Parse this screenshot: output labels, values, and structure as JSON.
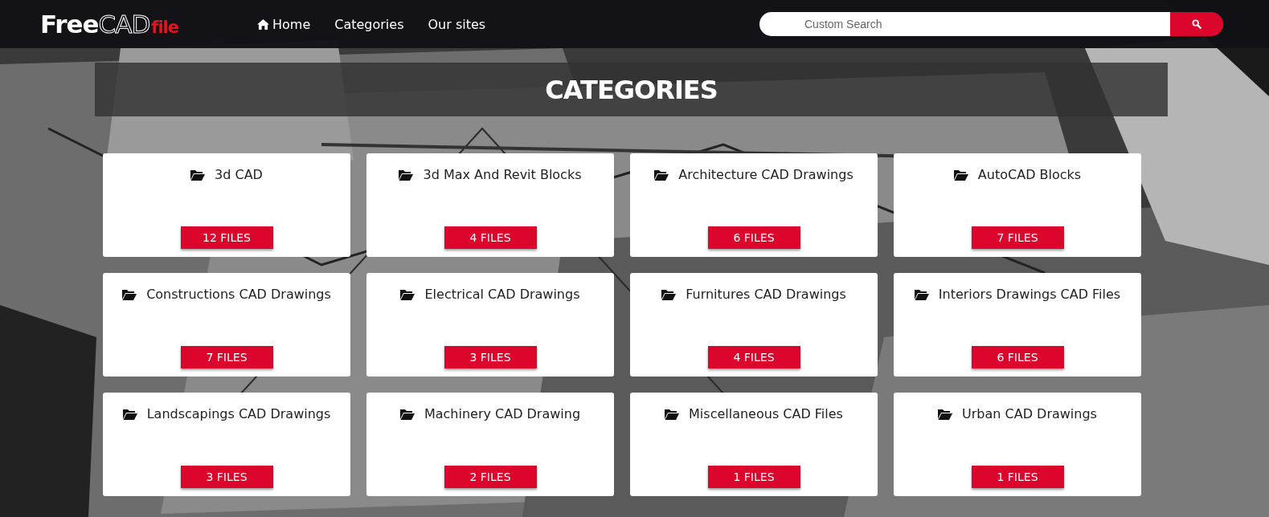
{
  "logo": {
    "free": "Free",
    "cad": "CAD",
    "file": "file"
  },
  "nav": [
    {
      "label": "Home",
      "kind": "home"
    },
    {
      "label": "Categories",
      "kind": "link"
    },
    {
      "label": "Our sites",
      "kind": "link"
    }
  ],
  "search": {
    "placeholder": "Custom Search"
  },
  "heading": "CATEGORIES",
  "categories": [
    {
      "name": "3d CAD",
      "count": "12 FILES"
    },
    {
      "name": "3d Max And Revit Blocks",
      "count": "4 FILES"
    },
    {
      "name": "Architecture CAD Drawings",
      "count": "6 FILES"
    },
    {
      "name": "AutoCAD Blocks",
      "count": "7 FILES"
    },
    {
      "name": "Constructions CAD Drawings",
      "count": "7 FILES"
    },
    {
      "name": "Electrical CAD Drawings",
      "count": "3 FILES"
    },
    {
      "name": "Furnitures CAD Drawings",
      "count": "4 FILES"
    },
    {
      "name": "Interiors Drawings CAD Files",
      "count": "6 FILES"
    },
    {
      "name": "Landscapings CAD Drawings",
      "count": "3 FILES"
    },
    {
      "name": "Machinery CAD Drawing",
      "count": "2 FILES"
    },
    {
      "name": "Miscellaneous CAD Files",
      "count": "1 FILES"
    },
    {
      "name": "Urban CAD Drawings",
      "count": "1 FILES"
    }
  ]
}
